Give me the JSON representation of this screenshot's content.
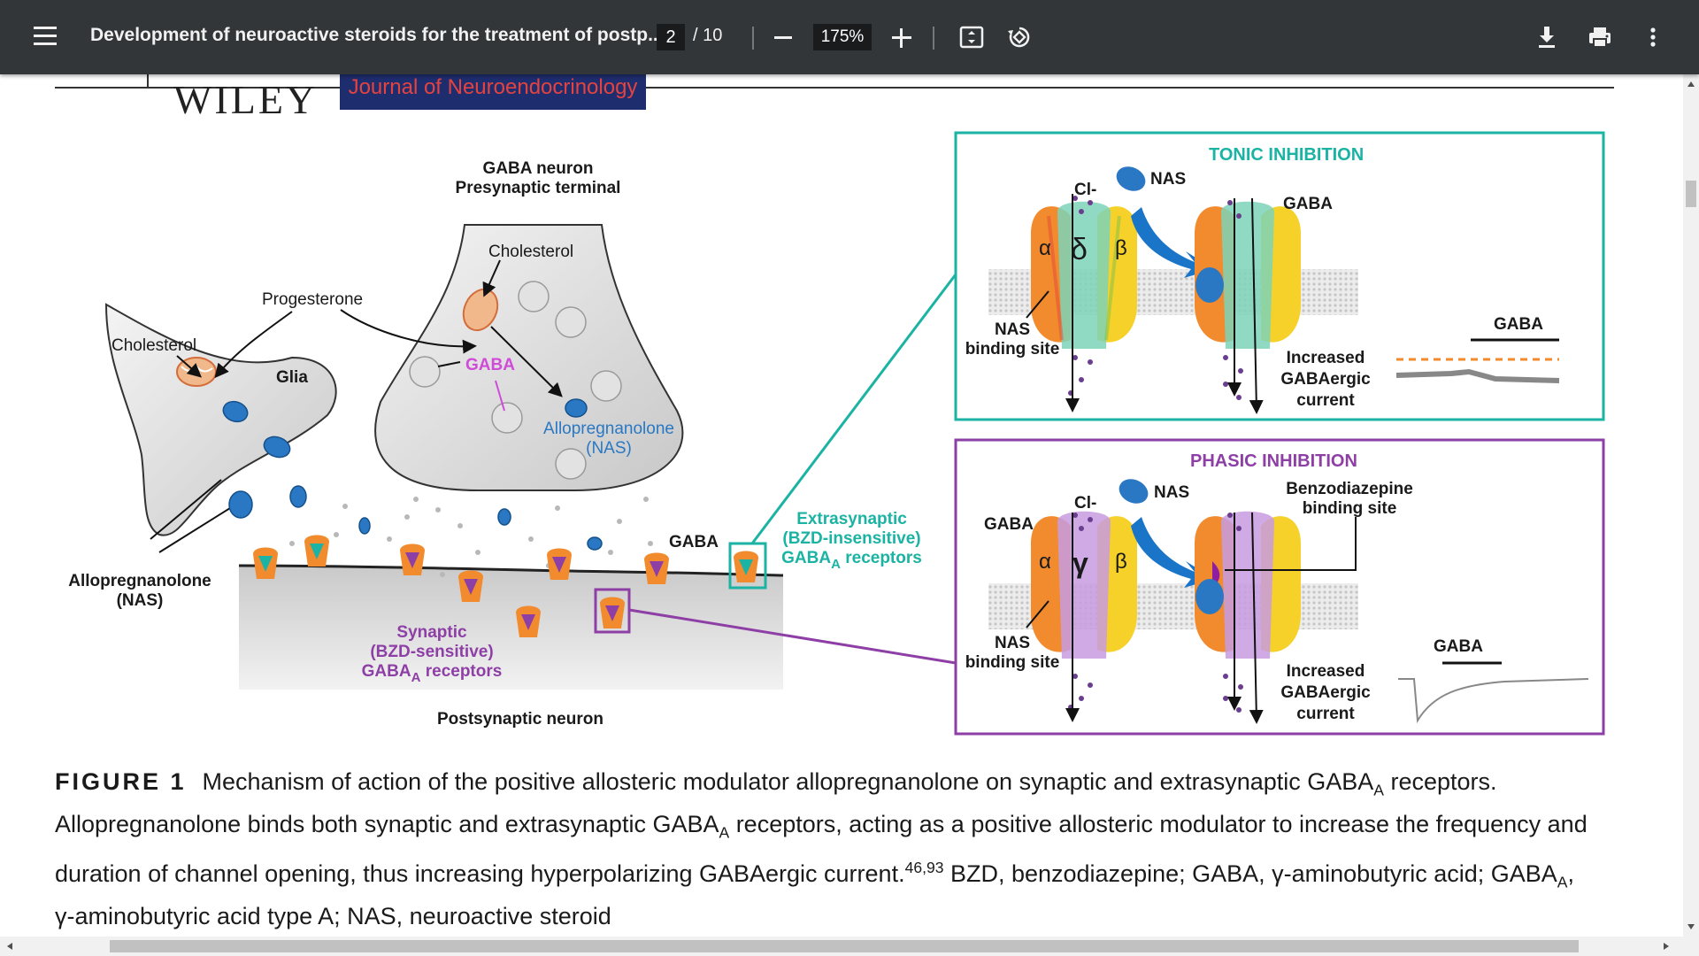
{
  "toolbar": {
    "title": "Development of neuroactive steroids for the treatment of postp...",
    "page_current": "2",
    "page_total": "/ 10",
    "zoom": "175%"
  },
  "header": {
    "publisher": "WILEY",
    "journal": "Journal of Neuroendocrinology"
  },
  "diagram": {
    "presynaptic_title": [
      "GABA neuron",
      "Presynaptic terminal"
    ],
    "cholesterol_presyn": "Cholesterol",
    "progesterone": "Progesterone",
    "cholesterol_glia": "Cholesterol",
    "glia": "Glia",
    "gaba_presyn": "GABA",
    "allo_presyn": [
      "Allopregnanolone",
      "(NAS)"
    ],
    "allo_left": [
      "Allopregnanolone",
      "(NAS)"
    ],
    "gaba_cleft": "GABA",
    "extrasynaptic": [
      "Extrasynaptic",
      "(BZD-insensitive)",
      "GABA",
      "receptors"
    ],
    "synaptic": [
      "Synaptic",
      "(BZD-sensitive)",
      "GABA",
      "receptors"
    ],
    "subscript_a": "A",
    "postsynaptic": "Postsynaptic neuron",
    "tonic": {
      "title": "TONIC INHIBITION",
      "cl": "Cl-",
      "nas": "NAS",
      "gaba": "GABA",
      "alpha": "α",
      "delta": "δ",
      "beta": "β",
      "nas_site": [
        "NAS",
        "binding site"
      ],
      "increased": [
        "Increased",
        "GABAergic",
        "current"
      ],
      "trace_label": "GABA"
    },
    "phasic": {
      "title": "PHASIC INHIBITION",
      "cl": "Cl-",
      "nas": "NAS",
      "gaba": "GABA",
      "alpha": "α",
      "gamma": "γ",
      "beta": "β",
      "bzd_site": [
        "Benzodiazepine",
        "binding site"
      ],
      "nas_site": [
        "NAS",
        "binding site"
      ],
      "increased": [
        "Increased",
        "GABAergic",
        "current"
      ],
      "trace_label": "GABA"
    }
  },
  "caption": {
    "label": "FIGURE 1",
    "p1": "Mechanism of action of the positive allosteric modulator allopregnanolone on synaptic and extrasynaptic GABA",
    "p2": " receptors. Allopregnanolone binds both synaptic and extrasynaptic GABA",
    "p3": " receptors, acting as a positive allosteric modulator to increase the frequency and duration of channel opening, thus increasing hyperpolarizing GABAergic current.",
    "refs": "46,93",
    "p4": " BZD, benzodiazepine; GABA, γ-aminobutyric acid; GABA",
    "p5": ", γ-aminobutyric acid type A; NAS, neuroactive steroid",
    "sub": "A"
  },
  "colors": {
    "toolbar_bg": "#323639",
    "teal": "#1bb3a3",
    "purple": "#8e3fa6",
    "journal_bg": "#1e2d6e",
    "journal_text": "#e5433f"
  },
  "icons": [
    "menu-icon",
    "fit-page-icon",
    "rotate-icon",
    "download-icon",
    "print-icon",
    "more-icon"
  ]
}
